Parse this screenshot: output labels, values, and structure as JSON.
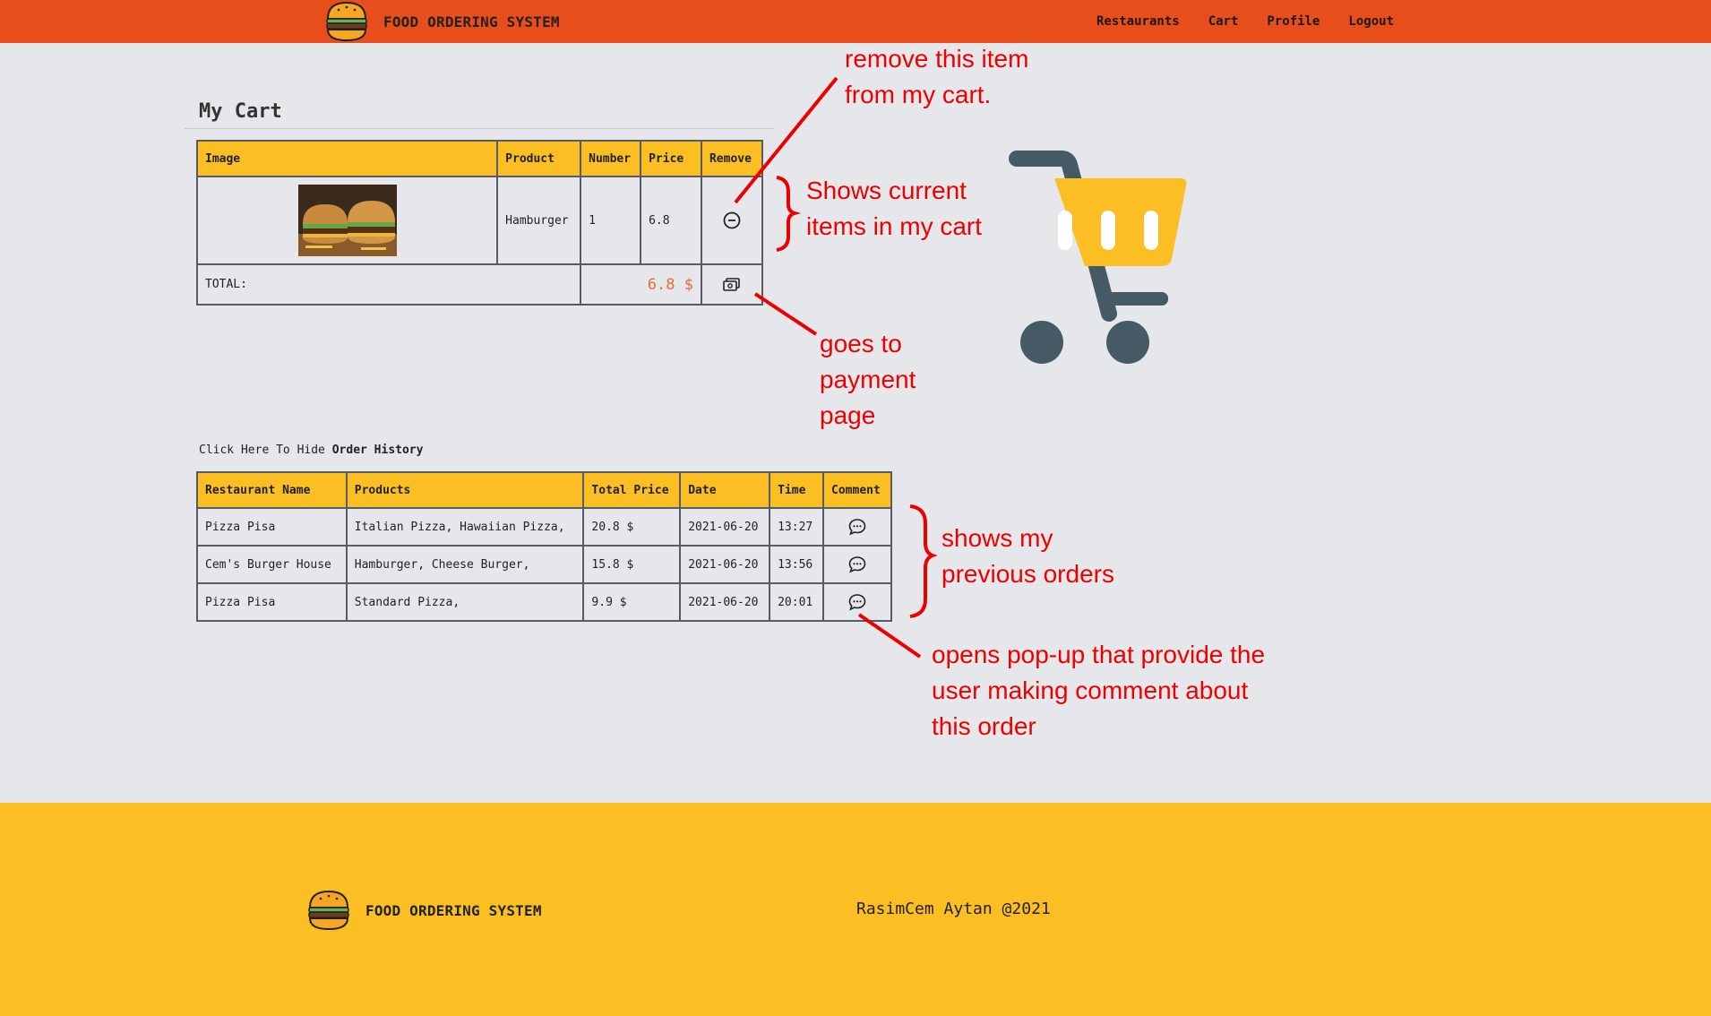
{
  "header": {
    "brand": "FOOD ORDERING SYSTEM",
    "nav": [
      "Restaurants",
      "Cart",
      "Profile",
      "Logout"
    ]
  },
  "cart": {
    "title": "My Cart",
    "columns": [
      "Image",
      "Product",
      "Number",
      "Price",
      "Remove"
    ],
    "items": [
      {
        "product": "Hamburger",
        "number": "1",
        "price": "6.8",
        "image_icon": "hamburger-photo",
        "remove_icon": "minus-circle-icon"
      }
    ],
    "total_label": "TOTAL:",
    "total_value": "6.8 $",
    "pay_icon": "payment-icon"
  },
  "history": {
    "toggle_prefix": "Click Here To Hide",
    "toggle_bold": "Order History",
    "columns": [
      "Restaurant Name",
      "Products",
      "Total Price",
      "Date",
      "Time",
      "Comment"
    ],
    "rows": [
      {
        "restaurant": "Pizza Pisa",
        "products": "Italian Pizza, Hawaiian Pizza,",
        "total": "20.8 $",
        "date": "2021-06-20",
        "time": "13:27"
      },
      {
        "restaurant": "Cem's Burger House",
        "products": "Hamburger, Cheese Burger,",
        "total": "15.8 $",
        "date": "2021-06-20",
        "time": "13:56"
      },
      {
        "restaurant": "Pizza Pisa",
        "products": "Standard Pizza,",
        "total": "9.9 $",
        "date": "2021-06-20",
        "time": "20:01"
      }
    ],
    "comment_icon": "comment-icon"
  },
  "annotations": {
    "remove": [
      "remove this item",
      "from my cart."
    ],
    "current": [
      "Shows current",
      "items in my cart"
    ],
    "payment": [
      "goes to",
      "payment",
      "page"
    ],
    "previous": [
      "shows my",
      "previous orders"
    ],
    "comment": [
      "opens pop-up that provide the",
      "user making comment about",
      "this order"
    ]
  },
  "footer": {
    "brand": "FOOD ORDERING SYSTEM",
    "copyright": "RasimCem Aytan @2021"
  },
  "colors": {
    "header_bg": "#e84d1c",
    "accent_yellow": "#fbbf24",
    "annotation_red": "#e00000",
    "cart_gray": "#455a64",
    "total_orange": "#e8693b"
  }
}
